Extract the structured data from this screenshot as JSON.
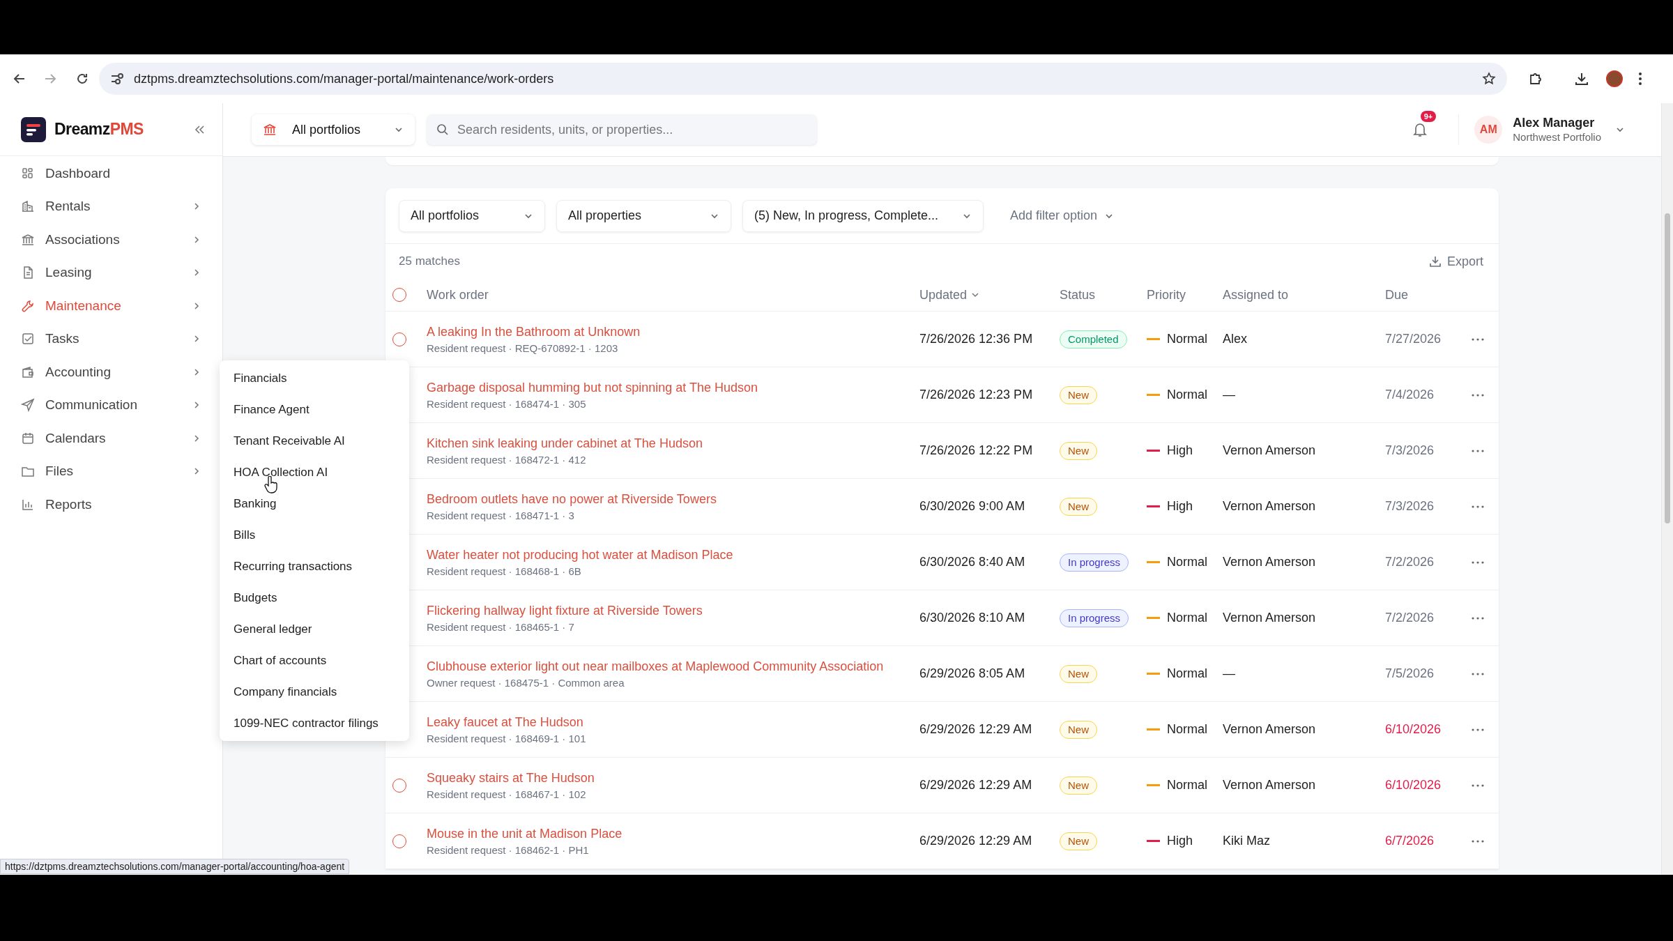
{
  "browser": {
    "url": "dztpms.dreamztechsolutions.com/manager-portal/maintenance/work-orders",
    "status_url": "https://dztpms.dreamztechsolutions.com/manager-portal/accounting/hoa-agent"
  },
  "brand": {
    "part_1": "Dreamz",
    "part_2": "PMS"
  },
  "sidebar": {
    "items": [
      {
        "label": "Dashboard",
        "has_submenu": false,
        "selected": false
      },
      {
        "label": "Rentals",
        "has_submenu": true,
        "selected": false
      },
      {
        "label": "Associations",
        "has_submenu": true,
        "selected": false
      },
      {
        "label": "Leasing",
        "has_submenu": true,
        "selected": false
      },
      {
        "label": "Maintenance",
        "has_submenu": true,
        "selected": true
      },
      {
        "label": "Tasks",
        "has_submenu": true,
        "selected": false
      },
      {
        "label": "Accounting",
        "has_submenu": true,
        "selected": false
      },
      {
        "label": "Communication",
        "has_submenu": true,
        "selected": false
      },
      {
        "label": "Calendars",
        "has_submenu": true,
        "selected": false
      },
      {
        "label": "Files",
        "has_submenu": true,
        "selected": false
      },
      {
        "label": "Reports",
        "has_submenu": false,
        "selected": false
      }
    ]
  },
  "submenu": {
    "items": [
      "Financials",
      "Finance Agent",
      "Tenant Receivable AI",
      "HOA Collection AI",
      "Banking",
      "Bills",
      "Recurring transactions",
      "Budgets",
      "General ledger",
      "Chart of accounts",
      "Company financials",
      "1099-NEC contractor filings"
    ]
  },
  "header": {
    "portfolio": "All portfolios",
    "search": {
      "placeholder": "Search residents, units, or properties..."
    },
    "notification_count": "9+",
    "user": {
      "initials": "AM",
      "name": "Alex Manager",
      "subtitle": "Northwest Portfolio"
    }
  },
  "filters": [
    {
      "kind": "select",
      "label": "All portfolios"
    },
    {
      "kind": "select",
      "label": "All properties"
    },
    {
      "kind": "select",
      "label": "(5) New, In progress, Complete..."
    },
    {
      "kind": "add",
      "label": "Add filter option"
    }
  ],
  "matches": "25 matches",
  "export": "Export",
  "columns": [
    {
      "label": "Work order",
      "sorted": false
    },
    {
      "label": "Updated",
      "sorted": true
    },
    {
      "label": "Status",
      "sorted": false
    },
    {
      "label": "Priority",
      "sorted": false
    },
    {
      "label": "Assigned to",
      "sorted": false
    },
    {
      "label": "Due",
      "sorted": false
    }
  ],
  "rows": [
    {
      "title": "A leaking In the Bathroom at Unknown",
      "subtitle": "Resident request · REQ-670892-1 · 1203",
      "updated": "7/26/2026 12:36 PM",
      "status": {
        "label": "Completed",
        "kind": "completed"
      },
      "priority": {
        "label": "Normal",
        "kind": "normal"
      },
      "assigned": "Alex",
      "due": "7/27/2026",
      "overdue": false
    },
    {
      "title": "Garbage disposal humming but not spinning at The Hudson",
      "subtitle": "Resident request · 168474-1 · 305",
      "updated": "7/26/2026 12:23 PM",
      "status": {
        "label": "New",
        "kind": "new"
      },
      "priority": {
        "label": "Normal",
        "kind": "normal"
      },
      "assigned": "—",
      "due": "7/4/2026",
      "overdue": false
    },
    {
      "title": "Kitchen sink leaking under cabinet at The Hudson",
      "subtitle": "Resident request · 168472-1 · 412",
      "updated": "7/26/2026 12:22 PM",
      "status": {
        "label": "New",
        "kind": "new"
      },
      "priority": {
        "label": "High",
        "kind": "high"
      },
      "assigned": "Vernon Amerson",
      "due": "7/3/2026",
      "overdue": false
    },
    {
      "title": "Bedroom outlets have no power at Riverside Towers",
      "subtitle": "Resident request · 168471-1 · 3",
      "updated": "6/30/2026 9:00 AM",
      "status": {
        "label": "New",
        "kind": "new"
      },
      "priority": {
        "label": "High",
        "kind": "high"
      },
      "assigned": "Vernon Amerson",
      "due": "7/3/2026",
      "overdue": false
    },
    {
      "title": "Water heater not producing hot water at Madison Place",
      "subtitle": "Resident request · 168468-1 · 6B",
      "updated": "6/30/2026 8:40 AM",
      "status": {
        "label": "In progress",
        "kind": "in_progress"
      },
      "priority": {
        "label": "Normal",
        "kind": "normal"
      },
      "assigned": "Vernon Amerson",
      "due": "7/2/2026",
      "overdue": false
    },
    {
      "title": "Flickering hallway light fixture at Riverside Towers",
      "subtitle": "Resident request · 168465-1 · 7",
      "updated": "6/30/2026 8:10 AM",
      "status": {
        "label": "In progress",
        "kind": "in_progress"
      },
      "priority": {
        "label": "Normal",
        "kind": "normal"
      },
      "assigned": "Vernon Amerson",
      "due": "7/2/2026",
      "overdue": false
    },
    {
      "title": "Clubhouse exterior light out near mailboxes at Maplewood Community Association",
      "subtitle": "Owner request · 168475-1 · Common area",
      "updated": "6/29/2026 8:05 AM",
      "status": {
        "label": "New",
        "kind": "new"
      },
      "priority": {
        "label": "Normal",
        "kind": "normal"
      },
      "assigned": "—",
      "due": "7/5/2026",
      "overdue": false
    },
    {
      "title": "Leaky faucet at The Hudson",
      "subtitle": "Resident request · 168469-1 · 101",
      "updated": "6/29/2026 12:29 AM",
      "status": {
        "label": "New",
        "kind": "new"
      },
      "priority": {
        "label": "Normal",
        "kind": "normal"
      },
      "assigned": "Vernon Amerson",
      "due": "6/10/2026",
      "overdue": true
    },
    {
      "title": "Squeaky stairs at The Hudson",
      "subtitle": "Resident request · 168467-1 · 102",
      "updated": "6/29/2026 12:29 AM",
      "status": {
        "label": "New",
        "kind": "new"
      },
      "priority": {
        "label": "Normal",
        "kind": "normal"
      },
      "assigned": "Vernon Amerson",
      "due": "6/10/2026",
      "overdue": true
    },
    {
      "title": "Mouse in the unit at Madison Place",
      "subtitle": "Resident request · 168462-1 · PH1",
      "updated": "6/29/2026 12:29 AM",
      "status": {
        "label": "New",
        "kind": "new"
      },
      "priority": {
        "label": "High",
        "kind": "high"
      },
      "assigned": "Kiki Maz",
      "due": "6/7/2026",
      "overdue": true
    }
  ]
}
